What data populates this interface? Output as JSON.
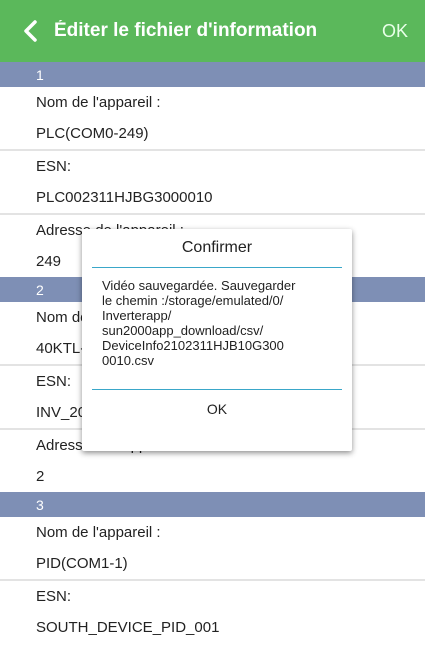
{
  "topbar": {
    "back_icon": "chevron-left-icon",
    "title": "Éditer le fichier d'information",
    "ok_label": "OK",
    "color": "#5bb85b"
  },
  "sections": [
    {
      "header": "1",
      "name_label": "Nom de l'appareil :",
      "name_value": "PLC(COM0-249)",
      "esn_label": "ESN:",
      "esn_value": "PLC002311HJBG3000010",
      "addr_label": "Adresse de l'appareil :",
      "addr_value": "249"
    },
    {
      "header": "2",
      "name_label": "Nom de l'appareil :",
      "name_value": "40KTL-JP(COM1-1)",
      "esn_label": "ESN:",
      "esn_value": "INV_2000000000000001",
      "addr_label": "Adresse de l'appareil :",
      "addr_value": "2"
    },
    {
      "header": "3",
      "name_label": "Nom de l'appareil :",
      "name_value": "PID(COM1-1)",
      "esn_label": "ESN:",
      "esn_value": "SOUTH_DEVICE_PID_001"
    }
  ],
  "dialog": {
    "title": "Confirmer",
    "message_lines": [
      "Vidéo sauvegardée. Sauvegarder",
      "le chemin :/storage/emulated/0/",
      "Inverterapp/",
      "sun2000app_download/csv/",
      "DeviceInfo2102311HJB10G300",
      "0010.csv"
    ],
    "ok_label": "OK",
    "accent": "#3aa7c9"
  },
  "colors": {
    "section_header": "#7e8fb5",
    "divider": "#e3e3e3"
  }
}
